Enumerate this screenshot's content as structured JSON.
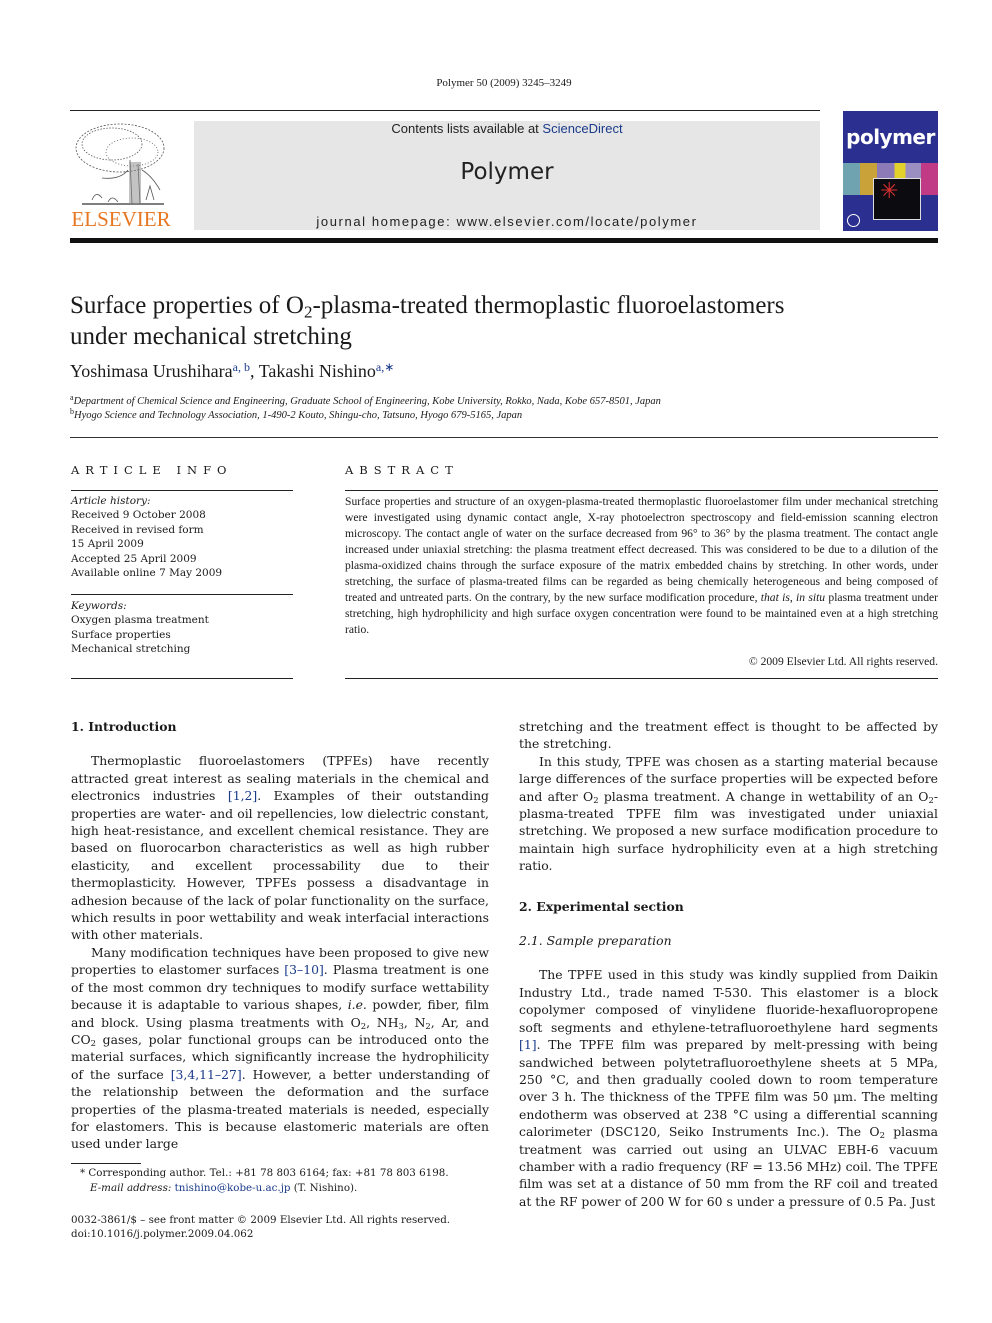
{
  "header": {
    "citation": "Polymer 50 (2009) 3245–3249",
    "contents_prefix": "Contents lists available at ",
    "contents_link": "ScienceDirect",
    "journal_title": "Polymer",
    "homepage": "journal homepage: www.elsevier.com/locate/polymer",
    "publisher_logo_text": "ELSEVIER",
    "cover_title": "polymer",
    "colors": {
      "publisher_orange": "#e87722",
      "link_blue": "#1a3a8a",
      "cover_blue": "#2b2f8f",
      "banner_gray": "#e6e6e6"
    }
  },
  "article": {
    "title_part1": "Surface properties of O",
    "title_sub": "2",
    "title_part2": "-plasma-treated thermoplastic fluoroelastomers",
    "title_line2": "under mechanical stretching",
    "authors": [
      {
        "name": "Yoshimasa Urushihara",
        "marks": "a, b",
        "sep": ", "
      },
      {
        "name": "Takashi Nishino",
        "marks": "a,∗",
        "sep": ""
      }
    ],
    "affiliations": [
      {
        "mark": "a",
        "text": "Department of Chemical Science and Engineering, Graduate School of Engineering, Kobe University, Rokko, Nada, Kobe 657-8501, Japan"
      },
      {
        "mark": "b",
        "text": "Hyogo Science and Technology Association, 1-490-2 Kouto, Shingu-cho, Tatsuno, Hyogo 679-5165, Japan"
      }
    ]
  },
  "article_info": {
    "heading": "ARTICLE INFO",
    "history_label": "Article history:",
    "history": [
      "Received 9 October 2008",
      "Received in revised form",
      "15 April 2009",
      "Accepted 25 April 2009",
      "Available online 7 May 2009"
    ],
    "keywords_label": "Keywords:",
    "keywords": [
      "Oxygen plasma treatment",
      "Surface properties",
      "Mechanical stretching"
    ]
  },
  "abstract": {
    "heading": "ABSTRACT",
    "text_a": "Surface properties and structure of an oxygen-plasma-treated thermoplastic fluoroelastomer film under mechanical stretching were investigated using dynamic contact angle, X-ray photoelectron spectroscopy and field-emission scanning electron microscopy. The contact angle of water on the surface decreased from 96° to 36° by the plasma treatment. The contact angle increased under uniaxial stretching: the plasma treatment effect decreased. This was considered to be due to a dilution of the plasma-oxidized chains through the surface exposure of the matrix embedded chains by stretching. In other words, under stretching, the surface of plasma-treated films can be regarded as being chemically heterogeneous and being composed of treated and untreated parts. On the contrary, by the new surface modification procedure, ",
    "text_italic1": "that is",
    "text_comma": ", ",
    "text_italic2": "in situ",
    "text_b": " plasma treatment under stretching, high hydrophilicity and high surface oxygen concentration were found to be maintained even at a high stretching ratio.",
    "copyright": "© 2009 Elsevier Ltd. All rights reserved."
  },
  "body": {
    "sec1_heading": "1.  Introduction",
    "p1": {
      "a": "Thermoplastic fluoroelastomers (TPFEs) have recently attracted great interest as sealing materials in the chemical and electronics industries ",
      "ref1": "[1,2]",
      "b": ". Examples of their outstanding properties are water- and oil repellencies, low dielectric constant, high heat-resistance, and excellent chemical resistance. They are based on fluorocarbon characteristics as well as high rubber elasticity, and excellent processability due to their thermoplasticity. However, TPFEs possess a disadvantage in adhesion because of the lack of polar functionality on the surface, which results in poor wettability and weak interfacial interactions with other materials."
    },
    "p2": {
      "a": "Many modification techniques have been proposed to give new properties to elastomer surfaces ",
      "ref1": "[3–10]",
      "b": ". Plasma treatment is one of the most common dry techniques to modify surface wettability because it is adaptable to various shapes, ",
      "ie": "i.e.",
      "c": " powder, fiber, film and block. Using plasma treatments with O",
      "s1": "2",
      "d": ", NH",
      "s2": "3",
      "e": ", N",
      "s3": "2",
      "f": ", Ar, and CO",
      "s4": "2",
      "g": " gases, polar functional groups can be introduced onto the material surfaces, which significantly increase the hydrophilicity of the surface ",
      "ref2": "[3,4,11–27]",
      "h": ". However, a better understanding of the relationship between the deformation and the surface properties of the plasma-treated materials is needed, especially for elastomers. This is because elastomeric materials are often used under large"
    },
    "p3_cont": "stretching and the treatment effect is thought to be affected by the stretching.",
    "p4": {
      "a": "In this study, TPFE was chosen as a starting material because large differences of the surface properties will be expected before and after O",
      "s1": "2",
      "b": " plasma treatment. A change in wettability of an O",
      "s2": "2",
      "c": "-plasma-treated TPFE film was investigated under uniaxial stretching. We proposed a new surface modification procedure to maintain high surface hydrophilicity even at a high stretching ratio."
    },
    "sec2_heading": "2.  Experimental section",
    "sec21_heading": "2.1.  Sample preparation",
    "p5": {
      "a": "The TPFE used in this study was kindly supplied from Daikin Industry Ltd., trade named T-530. This elastomer is a block copolymer composed of vinylidene fluoride-hexafluoropropene soft segments and ethylene-tetrafluoroethylene hard segments ",
      "ref1": "[1]",
      "b": ". The TPFE film was prepared by melt-pressing with being sandwiched between polytetrafluoroethylene sheets at 5 MPa, 250 °C, and then gradually cooled down to room temperature over 3 h. The thickness of the TPFE film was 50 μm. The melting endotherm was observed at 238 °C using a differential scanning calorimeter (DSC120, Seiko Instruments Inc.). The O",
      "s1": "2",
      "c": " plasma treatment was carried out using an ULVAC EBH-6 vacuum chamber with a radio frequency (RF = 13.56 MHz) coil. The TPFE film was set at a distance of 50 mm from the RF coil and treated at the RF power of 200 W for 60 s under a pressure of 0.5 Pa. Just"
    }
  },
  "footnote": {
    "star": "*",
    "corresponding": " Corresponding author. Tel.: +81 78 803 6164; fax: +81 78 803 6198.",
    "email_label": "E-mail address: ",
    "email": "tnishino@kobe-u.ac.jp",
    "email_suffix": " (T. Nishino)."
  },
  "front_matter": {
    "issn_line": "0032-3861/$ – see front matter © 2009 Elsevier Ltd. All rights reserved.",
    "doi": "doi:10.1016/j.polymer.2009.04.062"
  }
}
